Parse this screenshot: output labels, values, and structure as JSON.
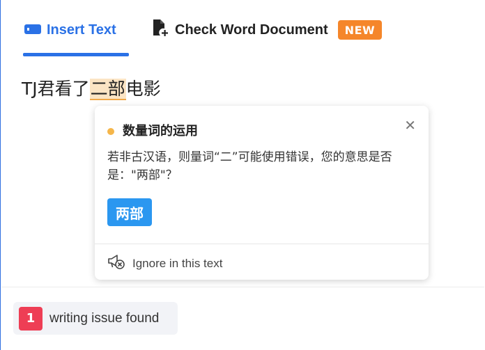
{
  "tabs": {
    "insert_text": "Insert Text",
    "check_word": "Check Word Document",
    "new_badge": "NEW"
  },
  "editor": {
    "before": "TJ君看了",
    "flagged": "二部",
    "after": "电影"
  },
  "popup": {
    "title": "数量词的运用",
    "message": "若非古汉语，则量词“二”可能使用错误，您的意思是否是：\"两部\"？",
    "suggestion": "两部",
    "ignore_label": "Ignore in this text",
    "severity_color": "#f5b64a"
  },
  "footer": {
    "issue_count": "1",
    "issue_label": "writing issue found"
  },
  "colors": {
    "accent": "#2a71e6",
    "new_badge": "#f5862a",
    "suggestion_button": "#2b97f0",
    "issue_count": "#ee3e55"
  },
  "icons": {
    "insert_text": "keyboard-bar-icon",
    "check_word": "document-add-icon",
    "close": "close-icon",
    "ignore": "megaphone-mute-icon",
    "severity": "dot-icon"
  }
}
